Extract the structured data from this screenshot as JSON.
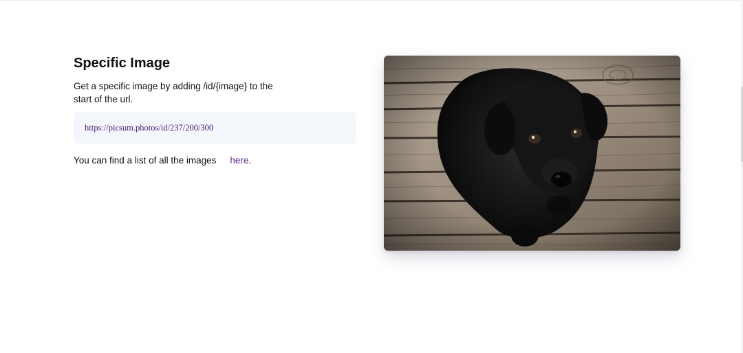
{
  "section": {
    "title": "Specific Image",
    "description": "Get a specific image by adding /id/{image} to the start of the url.",
    "example_url": "https://picsum.photos/id/237/200/300",
    "list_text": "You can find a list of all the images",
    "list_link_label": "here."
  },
  "image": {
    "subject": "black-puppy-on-wooden-floor",
    "colors": {
      "wood_light": "#a8998a",
      "wood_dark": "#5e5246",
      "fur": "#121212"
    }
  },
  "colors": {
    "link": "#5b2a86",
    "code_bg": "#f3f6fb",
    "code_text": "#4a1a6e"
  }
}
